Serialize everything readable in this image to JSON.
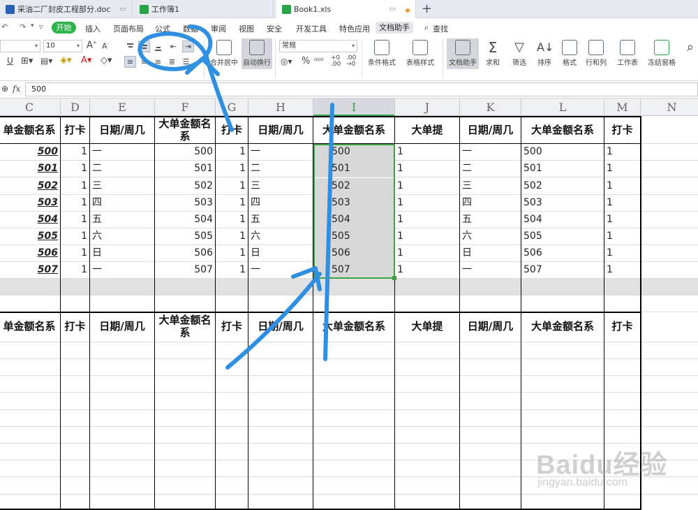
{
  "tabs": [
    {
      "label": "采油二厂封皮工程部分.doc",
      "color": "#2b5fb4"
    },
    {
      "label": "工作簿1",
      "color": "#2aa24a"
    },
    {
      "label": "Book1.xls",
      "color": "#2aa24a"
    }
  ],
  "menu": [
    "开始",
    "插入",
    "页面布局",
    "公式",
    "数据",
    "审阅",
    "视图",
    "安全",
    "开发工具",
    "特色应用",
    "文档助手",
    "查找"
  ],
  "ribbon": {
    "font_size": "10",
    "number_format": "常规",
    "merge_label": "合并居中",
    "wrap_label": "自动换行",
    "cond_format": "条件格式",
    "table_style": "表格样式",
    "doc_helper": "文档助手",
    "sum": "求和",
    "filter": "筛选",
    "sort": "排序",
    "format": "格式",
    "rowcol": "行和列",
    "sheet": "工作表",
    "freeze": "冻结窗格",
    "find": "查找"
  },
  "formula": {
    "fx": "fx",
    "value": "500"
  },
  "columns": [
    "C",
    "D",
    "E",
    "F",
    "G",
    "H",
    "I",
    "J",
    "K",
    "L",
    "M",
    "N"
  ],
  "selected_column": "I",
  "header_row": [
    "单金额名系",
    "打卡",
    "日期/周几",
    "大单金额名系",
    "打卡",
    "日期/周几",
    "大单金额名系",
    "大单提",
    "日期/周几",
    "大单金额名系",
    "打卡"
  ],
  "data": {
    "amounts": [
      "500",
      "501",
      "502",
      "503",
      "504",
      "505",
      "506",
      "507"
    ],
    "punch": "1",
    "weekdays": [
      "一",
      "二",
      "三",
      "四",
      "五",
      "六",
      "日",
      "一"
    ]
  },
  "watermark": {
    "main": "Baidu经验",
    "sub": "jingyan.baidu.com"
  },
  "colors": {
    "accent": "#2db34a",
    "selection": "#3aa343",
    "annotation": "#2f8fe0"
  }
}
